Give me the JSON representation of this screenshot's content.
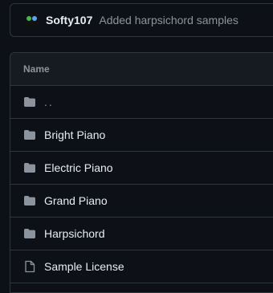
{
  "commit": {
    "author": "Softy107",
    "message": "Added harpsichord samples"
  },
  "table": {
    "header": "Name",
    "rows": [
      {
        "name": "..",
        "icon": "folder-icon"
      },
      {
        "name": "Bright Piano",
        "icon": "folder-icon"
      },
      {
        "name": "Electric Piano",
        "icon": "folder-icon"
      },
      {
        "name": "Grand Piano",
        "icon": "folder-icon"
      },
      {
        "name": "Harpsichord",
        "icon": "folder-icon"
      },
      {
        "name": "Sample License",
        "icon": "file-icon"
      }
    ]
  },
  "colors": {
    "background": "#0d1117",
    "header_background": "#161b22",
    "border": "#30363d",
    "text": "#e6edf3",
    "muted": "#8b949e",
    "icon": "#8b949e"
  }
}
